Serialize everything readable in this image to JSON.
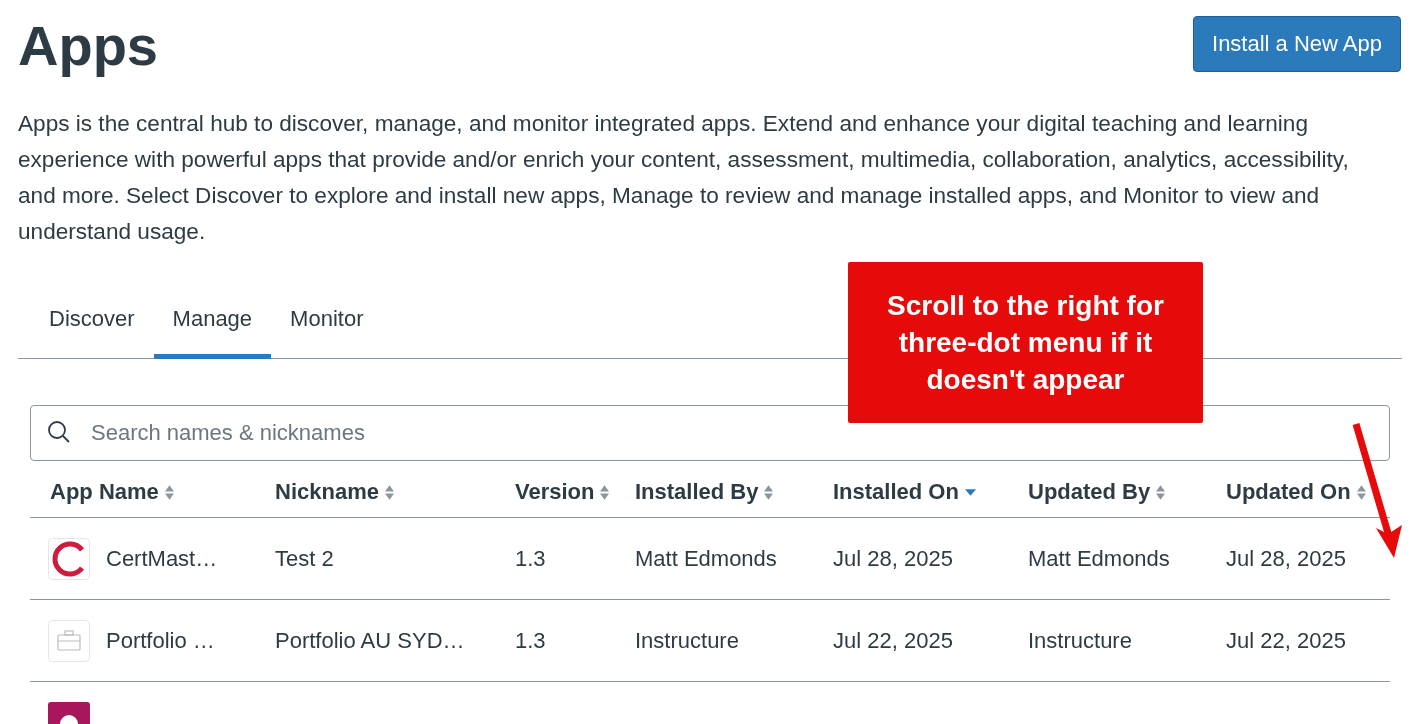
{
  "page": {
    "title": "Apps",
    "description": "Apps is the central hub to discover, manage, and monitor integrated apps. Extend and enhance your digital teaching and learning experience with powerful apps that provide and/or enrich your content, assessment, multimedia, collaboration, analytics, accessibility, and more. Select Discover to explore and install new apps, Manage to review and manage installed apps, and Monitor to view and understand usage.",
    "primary_button": "Install a New App"
  },
  "tabs": [
    {
      "label": "Discover",
      "selected": false
    },
    {
      "label": "Manage",
      "selected": true
    },
    {
      "label": "Monitor",
      "selected": false
    }
  ],
  "search": {
    "placeholder": "Search names & nicknames"
  },
  "table": {
    "columns": [
      {
        "label": "App Name",
        "sorted": false
      },
      {
        "label": "Nickname",
        "sorted": false
      },
      {
        "label": "Version",
        "sorted": false
      },
      {
        "label": "Installed By",
        "sorted": false
      },
      {
        "label": "Installed On",
        "sorted": true
      },
      {
        "label": "Updated By",
        "sorted": false
      },
      {
        "label": "Updated On",
        "sorted": false
      }
    ],
    "rows": [
      {
        "kind": "ring",
        "cells": [
          "CertMast…",
          "Test 2",
          "1.3",
          "Matt Edmonds",
          "Jul 28, 2025",
          "Matt Edmonds",
          "Jul 28, 2025"
        ]
      },
      {
        "kind": "briefcase",
        "cells": [
          "Portfolio …",
          "Portfolio AU SYD…",
          "1.3",
          "Instructure",
          "Jul 22, 2025",
          "Instructure",
          "Jul 22, 2025"
        ]
      },
      {
        "kind": "tile"
      }
    ]
  },
  "callout": {
    "text": "Scroll to the right for three-dot menu if it doesn't appear"
  }
}
